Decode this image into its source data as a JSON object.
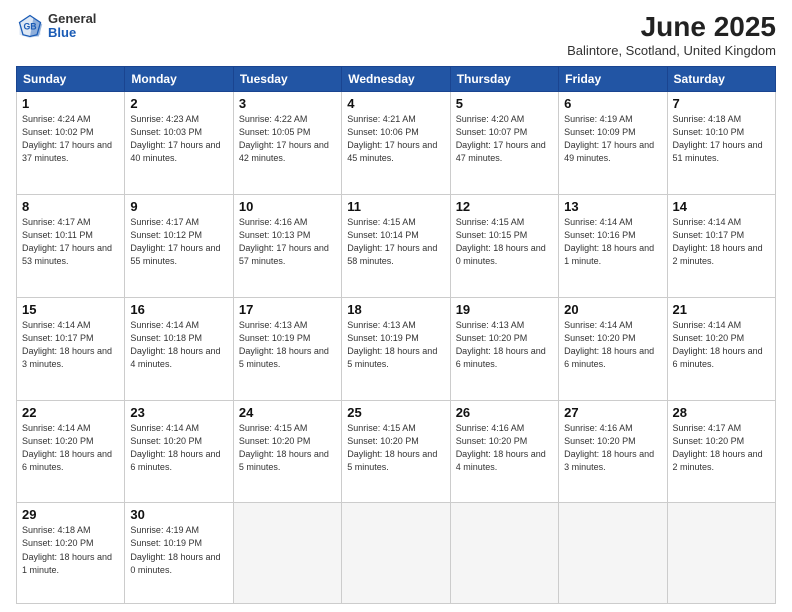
{
  "header": {
    "logo_general": "General",
    "logo_blue": "Blue",
    "month_title": "June 2025",
    "location": "Balintore, Scotland, United Kingdom"
  },
  "days_of_week": [
    "Sunday",
    "Monday",
    "Tuesday",
    "Wednesday",
    "Thursday",
    "Friday",
    "Saturday"
  ],
  "weeks": [
    [
      {
        "day": "1",
        "sunrise": "4:24 AM",
        "sunset": "10:02 PM",
        "daylight": "17 hours and 37 minutes."
      },
      {
        "day": "2",
        "sunrise": "4:23 AM",
        "sunset": "10:03 PM",
        "daylight": "17 hours and 40 minutes."
      },
      {
        "day": "3",
        "sunrise": "4:22 AM",
        "sunset": "10:05 PM",
        "daylight": "17 hours and 42 minutes."
      },
      {
        "day": "4",
        "sunrise": "4:21 AM",
        "sunset": "10:06 PM",
        "daylight": "17 hours and 45 minutes."
      },
      {
        "day": "5",
        "sunrise": "4:20 AM",
        "sunset": "10:07 PM",
        "daylight": "17 hours and 47 minutes."
      },
      {
        "day": "6",
        "sunrise": "4:19 AM",
        "sunset": "10:09 PM",
        "daylight": "17 hours and 49 minutes."
      },
      {
        "day": "7",
        "sunrise": "4:18 AM",
        "sunset": "10:10 PM",
        "daylight": "17 hours and 51 minutes."
      }
    ],
    [
      {
        "day": "8",
        "sunrise": "4:17 AM",
        "sunset": "10:11 PM",
        "daylight": "17 hours and 53 minutes."
      },
      {
        "day": "9",
        "sunrise": "4:17 AM",
        "sunset": "10:12 PM",
        "daylight": "17 hours and 55 minutes."
      },
      {
        "day": "10",
        "sunrise": "4:16 AM",
        "sunset": "10:13 PM",
        "daylight": "17 hours and 57 minutes."
      },
      {
        "day": "11",
        "sunrise": "4:15 AM",
        "sunset": "10:14 PM",
        "daylight": "17 hours and 58 minutes."
      },
      {
        "day": "12",
        "sunrise": "4:15 AM",
        "sunset": "10:15 PM",
        "daylight": "18 hours and 0 minutes."
      },
      {
        "day": "13",
        "sunrise": "4:14 AM",
        "sunset": "10:16 PM",
        "daylight": "18 hours and 1 minute."
      },
      {
        "day": "14",
        "sunrise": "4:14 AM",
        "sunset": "10:17 PM",
        "daylight": "18 hours and 2 minutes."
      }
    ],
    [
      {
        "day": "15",
        "sunrise": "4:14 AM",
        "sunset": "10:17 PM",
        "daylight": "18 hours and 3 minutes."
      },
      {
        "day": "16",
        "sunrise": "4:14 AM",
        "sunset": "10:18 PM",
        "daylight": "18 hours and 4 minutes."
      },
      {
        "day": "17",
        "sunrise": "4:13 AM",
        "sunset": "10:19 PM",
        "daylight": "18 hours and 5 minutes."
      },
      {
        "day": "18",
        "sunrise": "4:13 AM",
        "sunset": "10:19 PM",
        "daylight": "18 hours and 5 minutes."
      },
      {
        "day": "19",
        "sunrise": "4:13 AM",
        "sunset": "10:20 PM",
        "daylight": "18 hours and 6 minutes."
      },
      {
        "day": "20",
        "sunrise": "4:14 AM",
        "sunset": "10:20 PM",
        "daylight": "18 hours and 6 minutes."
      },
      {
        "day": "21",
        "sunrise": "4:14 AM",
        "sunset": "10:20 PM",
        "daylight": "18 hours and 6 minutes."
      }
    ],
    [
      {
        "day": "22",
        "sunrise": "4:14 AM",
        "sunset": "10:20 PM",
        "daylight": "18 hours and 6 minutes."
      },
      {
        "day": "23",
        "sunrise": "4:14 AM",
        "sunset": "10:20 PM",
        "daylight": "18 hours and 6 minutes."
      },
      {
        "day": "24",
        "sunrise": "4:15 AM",
        "sunset": "10:20 PM",
        "daylight": "18 hours and 5 minutes."
      },
      {
        "day": "25",
        "sunrise": "4:15 AM",
        "sunset": "10:20 PM",
        "daylight": "18 hours and 5 minutes."
      },
      {
        "day": "26",
        "sunrise": "4:16 AM",
        "sunset": "10:20 PM",
        "daylight": "18 hours and 4 minutes."
      },
      {
        "day": "27",
        "sunrise": "4:16 AM",
        "sunset": "10:20 PM",
        "daylight": "18 hours and 3 minutes."
      },
      {
        "day": "28",
        "sunrise": "4:17 AM",
        "sunset": "10:20 PM",
        "daylight": "18 hours and 2 minutes."
      }
    ],
    [
      {
        "day": "29",
        "sunrise": "4:18 AM",
        "sunset": "10:20 PM",
        "daylight": "18 hours and 1 minute."
      },
      {
        "day": "30",
        "sunrise": "4:19 AM",
        "sunset": "10:19 PM",
        "daylight": "18 hours and 0 minutes."
      },
      null,
      null,
      null,
      null,
      null
    ]
  ]
}
